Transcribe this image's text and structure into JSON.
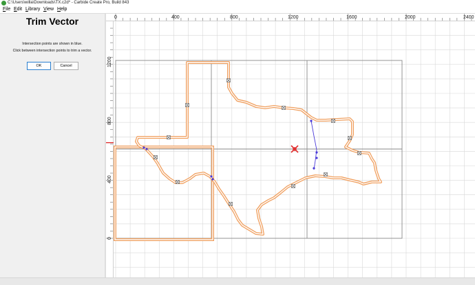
{
  "window": {
    "title": "C:\\Users\\willa\\Downloads\\TX.c2d* - Carbide Create Pro, Build 843"
  },
  "menu": [
    {
      "label": "File",
      "mnemonic": "F",
      "rest": "ile"
    },
    {
      "label": "Edit",
      "mnemonic": "E",
      "rest": "dit"
    },
    {
      "label": "Library",
      "mnemonic": "L",
      "rest": "ibrary"
    },
    {
      "label": "View",
      "mnemonic": "V",
      "rest": "iew"
    },
    {
      "label": "Help",
      "mnemonic": "H",
      "rest": "elp"
    }
  ],
  "panel": {
    "title": "Trim Vector",
    "instruction_1": "Intersection points are shown in blue.",
    "instruction_2": "Click between intersection points to trim a vector.",
    "ok_label": "OK",
    "cancel_label": "Cancel"
  },
  "rulers": {
    "x_labels": [
      "0",
      "400",
      "800",
      "1200",
      "1600",
      "2000",
      "2400"
    ],
    "y_labels": [
      "0",
      "400",
      "800",
      "1200"
    ]
  },
  "colors": {
    "vector": "#f0a060",
    "intersection": "#4a3ad8",
    "grid": "#d8d8d8",
    "stock": "#8a8a8a",
    "origin_marker": "#e03030"
  }
}
